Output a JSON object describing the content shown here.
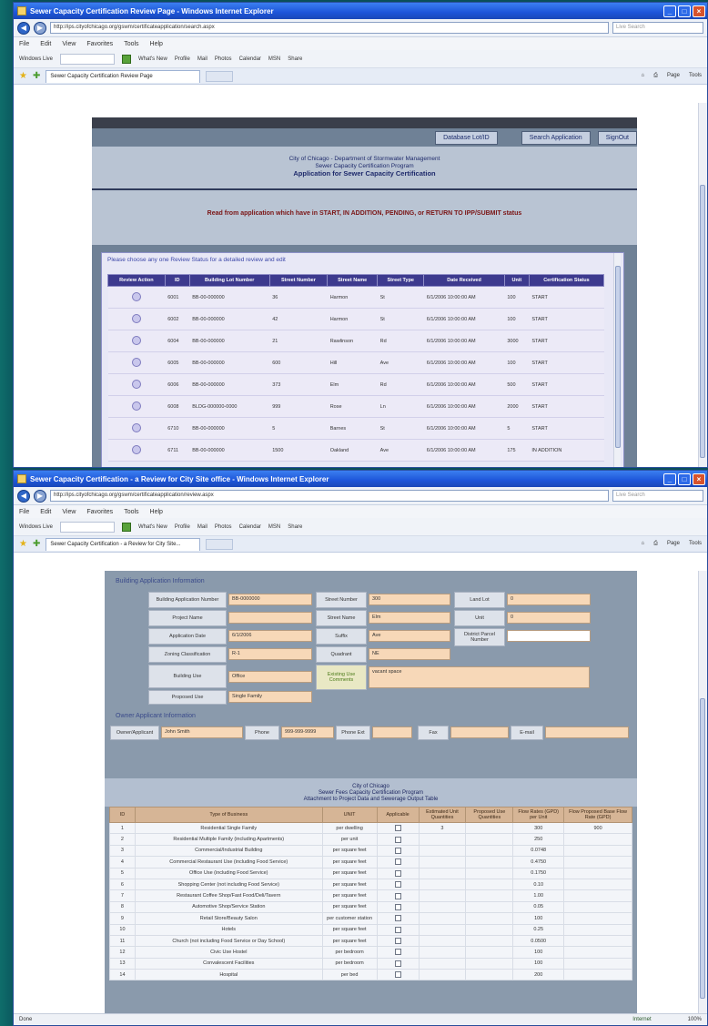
{
  "window1": {
    "title": "Sewer Capacity Certification Review Page - Windows Internet Explorer",
    "url": "http://ips.cityofchicago.org/gswm/certificateapplication/search.aspx",
    "search_placeholder": "Live Search",
    "menu": [
      "File",
      "Edit",
      "View",
      "Favorites",
      "Tools",
      "Help"
    ],
    "links_label": "Windows Live",
    "links_items": [
      "What's New",
      "Profile",
      "Mail",
      "Photos",
      "Calendar",
      "MSN",
      "Share"
    ],
    "tab_label": "Sewer Capacity Certification Review Page",
    "tab_tools": [
      "Page",
      "Tools"
    ],
    "nav_buttons": [
      "Database Lot/ID",
      "Search Application",
      "SignOut"
    ],
    "titles": [
      "City of Chicago - Department of Stormwater Management",
      "Sewer Capacity Certification Program"
    ],
    "main_title": "Application for Sewer Capacity Certification",
    "notice": "Read from application which have in START, IN ADDITION, PENDING, or RETURN TO IPP/SUBMIT status",
    "panel_title": "Please choose any one Review Status for a detailed review and edit",
    "table_headers": [
      "Review Action",
      "ID",
      "Building Lot Number",
      "Street Number",
      "Street Name",
      "Street Type",
      "Date Received",
      "Unit",
      "Certification Status"
    ],
    "rows": [
      [
        "6001",
        "BB-00-000000",
        "36",
        "Harmon",
        "St",
        "6/1/2006 10:00:00 AM",
        "100",
        "START"
      ],
      [
        "6002",
        "BB-00-000000",
        "42",
        "Harmon",
        "St",
        "6/1/2006 10:00:00 AM",
        "100",
        "START"
      ],
      [
        "6004",
        "BB-00-000000",
        "21",
        "Rawlinson",
        "Rd",
        "6/1/2006 10:00:00 AM",
        "3000",
        "START"
      ],
      [
        "6005",
        "BB-00-000000",
        "600",
        "Hill",
        "Ave",
        "6/1/2006 10:00:00 AM",
        "100",
        "START"
      ],
      [
        "6006",
        "BB-00-000000",
        "373",
        "Elm",
        "Rd",
        "6/1/2006 10:00:00 AM",
        "500",
        "START"
      ],
      [
        "6008",
        "BLDG-000000-0000",
        "999",
        "Rose",
        "Ln",
        "6/1/2006 10:00:00 AM",
        "2000",
        "START"
      ],
      [
        "6710",
        "BB-00-000000",
        "5",
        "Barnes",
        "St",
        "6/1/2006 10:00:00 AM",
        "5",
        "START"
      ],
      [
        "6711",
        "BB-00-000000",
        "1500",
        "Oakland",
        "Ave",
        "6/1/2006 10:00:00 AM",
        "175",
        "IN ADDITION"
      ]
    ]
  },
  "window2": {
    "title": "Sewer Capacity Certification - a Review for City Site office - Windows Internet Explorer",
    "url": "http://ips.cityofchicago.org/gswm/certificateapplication/review.aspx",
    "search_placeholder": "Live Search",
    "menu": [
      "File",
      "Edit",
      "View",
      "Favorites",
      "Tools",
      "Help"
    ],
    "links_label": "Windows Live",
    "links_items": [
      "What's New",
      "Profile",
      "Mail",
      "Photos",
      "Calendar",
      "MSN",
      "Share"
    ],
    "tab_label": "Sewer Capacity Certification - a Review for City Site...",
    "tab_tools": [
      "Page",
      "Tools"
    ],
    "building_section": "Building Application Information",
    "labels": {
      "bldg_app_num": "Building Application Number",
      "project_name": "Project Name",
      "app_date": "Application Date",
      "zoning": "Zoning Classification",
      "building_use": "Building Use",
      "proposed_use": "Proposed Use",
      "street_number": "Street Number",
      "street_name": "Street Name",
      "suffix": "Suffix",
      "quadrant": "Quadrant",
      "existing_use": "Existing Use Comments",
      "land_lot": "Land Lot",
      "unit": "Unit",
      "district": "District Parcel Number"
    },
    "values": {
      "bldg_app_num": "BB-0000000",
      "project_name": "",
      "app_date": "6/1/2006",
      "zoning": "R-1",
      "building_use": "Office",
      "proposed_use": "Single Family",
      "street_number": "300",
      "street_name": "Elm",
      "suffix": "Ave",
      "quadrant": "NE",
      "existing_use": "vacant space",
      "land_lot": "0",
      "unit": "0",
      "district": ""
    },
    "owner_section": "Owner Applicant Information",
    "owner_labels": [
      "Owner/Applicant",
      "Phone",
      "Phone Ext",
      "Fax",
      "E-mail"
    ],
    "owner_values": [
      "John Smith",
      "999-999-9999",
      "",
      "",
      ""
    ],
    "meter_titles": [
      "City of Chicago",
      "Sewer Fees Capacity Certification Program",
      "Attachment to Project Data and Sewerage Output Table"
    ],
    "rate_headers": [
      "ID",
      "Type of Business",
      "UNIT",
      "Applicable",
      "Estimated Unit Quantities",
      "Proposed Use Quantities",
      "Flow Rates (GPD) per Unit",
      "Flow Proposed Base Flow Rate (GPD)"
    ],
    "rate_rows": [
      [
        "1",
        "Residential Single Family",
        "per dwelling",
        "3",
        "",
        "300",
        "900"
      ],
      [
        "2",
        "Residential Multiple Family (including Apartments)",
        "per unit",
        "",
        "",
        "250",
        ""
      ],
      [
        "3",
        "Commercial/Industrial Building",
        "per square feet",
        "",
        "",
        "0.0748",
        ""
      ],
      [
        "4",
        "Commercial Restaurant Use (including Food Service)",
        "per square feet",
        "",
        "",
        "0.4750",
        ""
      ],
      [
        "5",
        "Office Use (including Food Service)",
        "per square feet",
        "",
        "",
        "0.1750",
        ""
      ],
      [
        "6",
        "Shopping Center (not including Food Service)",
        "per square feet",
        "",
        "",
        "0.10",
        ""
      ],
      [
        "7",
        "Restaurant Coffee Shop/Fast Food/Deli/Tavern",
        "per square feet",
        "",
        "",
        "1.00",
        ""
      ],
      [
        "8",
        "Automotive Shop/Service Station",
        "per square feet",
        "",
        "",
        "0.05",
        ""
      ],
      [
        "9",
        "Retail Store/Beauty Salon",
        "per customer station",
        "",
        "",
        "100",
        ""
      ],
      [
        "10",
        "Hotels",
        "per square feet",
        "",
        "",
        "0.25",
        ""
      ],
      [
        "11",
        "Church (not including Food Service or Day School)",
        "per square feet",
        "",
        "",
        "0.0500",
        ""
      ],
      [
        "12",
        "Civic Use Hostel",
        "per bedroom",
        "",
        "",
        "100",
        ""
      ],
      [
        "13",
        "Convalescent Facilities",
        "per bedroom",
        "",
        "",
        "100",
        ""
      ],
      [
        "14",
        "Hospital",
        "per bed",
        "",
        "",
        "200",
        ""
      ]
    ],
    "status_left": "Done",
    "status_zone": "Internet",
    "status_zoom": "100%"
  }
}
